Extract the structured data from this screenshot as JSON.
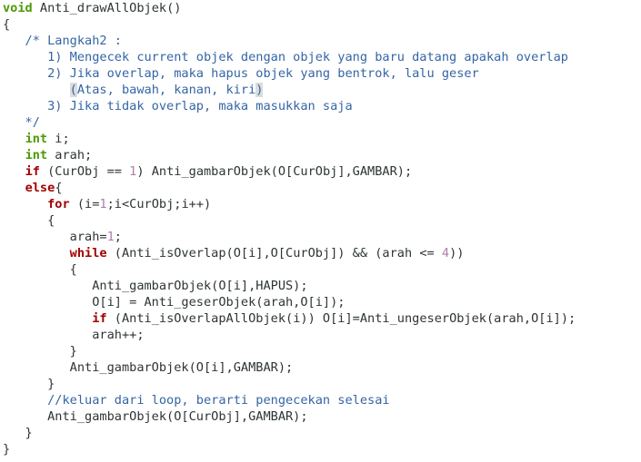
{
  "editor": {
    "colors": {
      "background": "#ffffff",
      "text": "#2e3436",
      "keyword": "#a40000",
      "type": "#4e9a06",
      "comment": "#3465a4",
      "number": "#ad7fa8",
      "bracket_highlight": "#dcdcdc"
    },
    "lines": [
      [
        {
          "t": "void",
          "k": "type"
        },
        {
          "t": " Anti_drawAllObjek()",
          "k": "normal"
        }
      ],
      [
        {
          "t": "{",
          "k": "normal"
        }
      ],
      [
        {
          "t": "   /* Langkah2 :",
          "k": "comment"
        }
      ],
      [
        {
          "t": "      1) Mengecek current objek dengan objek yang baru datang apakah overlap",
          "k": "comment"
        }
      ],
      [
        {
          "t": "      2) Jika overlap, maka hapus objek yang bentrok, lalu geser",
          "k": "comment"
        }
      ],
      [
        {
          "t": "         ",
          "k": "comment"
        },
        {
          "t": "(",
          "k": "cursor"
        },
        {
          "t": "Atas, bawah, kanan, kiri",
          "k": "comment"
        },
        {
          "t": ")",
          "k": "cursor"
        }
      ],
      [
        {
          "t": "      3) Jika tidak overlap, maka masukkan saja",
          "k": "comment"
        }
      ],
      [
        {
          "t": "   */",
          "k": "comment"
        }
      ],
      [
        {
          "t": "   ",
          "k": "normal"
        },
        {
          "t": "int",
          "k": "type"
        },
        {
          "t": " i;",
          "k": "normal"
        }
      ],
      [
        {
          "t": "   ",
          "k": "normal"
        },
        {
          "t": "int",
          "k": "type"
        },
        {
          "t": " arah;",
          "k": "normal"
        }
      ],
      [
        {
          "t": "   ",
          "k": "normal"
        },
        {
          "t": "if",
          "k": "keyword"
        },
        {
          "t": " (CurObj == ",
          "k": "normal"
        },
        {
          "t": "1",
          "k": "number"
        },
        {
          "t": ") Anti_gambarObjek(O[CurObj],GAMBAR);",
          "k": "normal"
        }
      ],
      [
        {
          "t": "   ",
          "k": "normal"
        },
        {
          "t": "else",
          "k": "keyword"
        },
        {
          "t": "{",
          "k": "normal"
        }
      ],
      [
        {
          "t": "      ",
          "k": "normal"
        },
        {
          "t": "for",
          "k": "keyword"
        },
        {
          "t": " (i=",
          "k": "normal"
        },
        {
          "t": "1",
          "k": "number"
        },
        {
          "t": ";i<CurObj;i++)",
          "k": "normal"
        }
      ],
      [
        {
          "t": "      {",
          "k": "normal"
        }
      ],
      [
        {
          "t": "         arah=",
          "k": "normal"
        },
        {
          "t": "1",
          "k": "number"
        },
        {
          "t": ";",
          "k": "normal"
        }
      ],
      [
        {
          "t": "         ",
          "k": "normal"
        },
        {
          "t": "while",
          "k": "keyword"
        },
        {
          "t": " (Anti_isOverlap(O[i],O[CurObj]) && (arah <= ",
          "k": "normal"
        },
        {
          "t": "4",
          "k": "number"
        },
        {
          "t": "))",
          "k": "normal"
        }
      ],
      [
        {
          "t": "         {",
          "k": "normal"
        }
      ],
      [
        {
          "t": "            Anti_gambarObjek(O[i],HAPUS);",
          "k": "normal"
        }
      ],
      [
        {
          "t": "            O[i] = Anti_geserObjek(arah,O[i]);",
          "k": "normal"
        }
      ],
      [
        {
          "t": "            ",
          "k": "normal"
        },
        {
          "t": "if",
          "k": "keyword"
        },
        {
          "t": " (Anti_isOverlapAllObjek(i)) O[i]=Anti_ungeserObjek(arah,O[i]);",
          "k": "normal"
        }
      ],
      [
        {
          "t": "            arah++;",
          "k": "normal"
        }
      ],
      [
        {
          "t": "         }",
          "k": "normal"
        }
      ],
      [
        {
          "t": "         Anti_gambarObjek(O[i],GAMBAR);",
          "k": "normal"
        }
      ],
      [
        {
          "t": "      }",
          "k": "normal"
        }
      ],
      [
        {
          "t": "      //keluar dari loop, berarti pengecekan selesai",
          "k": "comment"
        }
      ],
      [
        {
          "t": "      Anti_gambarObjek(O[CurObj],GAMBAR);",
          "k": "normal"
        }
      ],
      [
        {
          "t": "   }",
          "k": "normal"
        }
      ],
      [
        {
          "t": "}",
          "k": "normal"
        }
      ]
    ]
  }
}
